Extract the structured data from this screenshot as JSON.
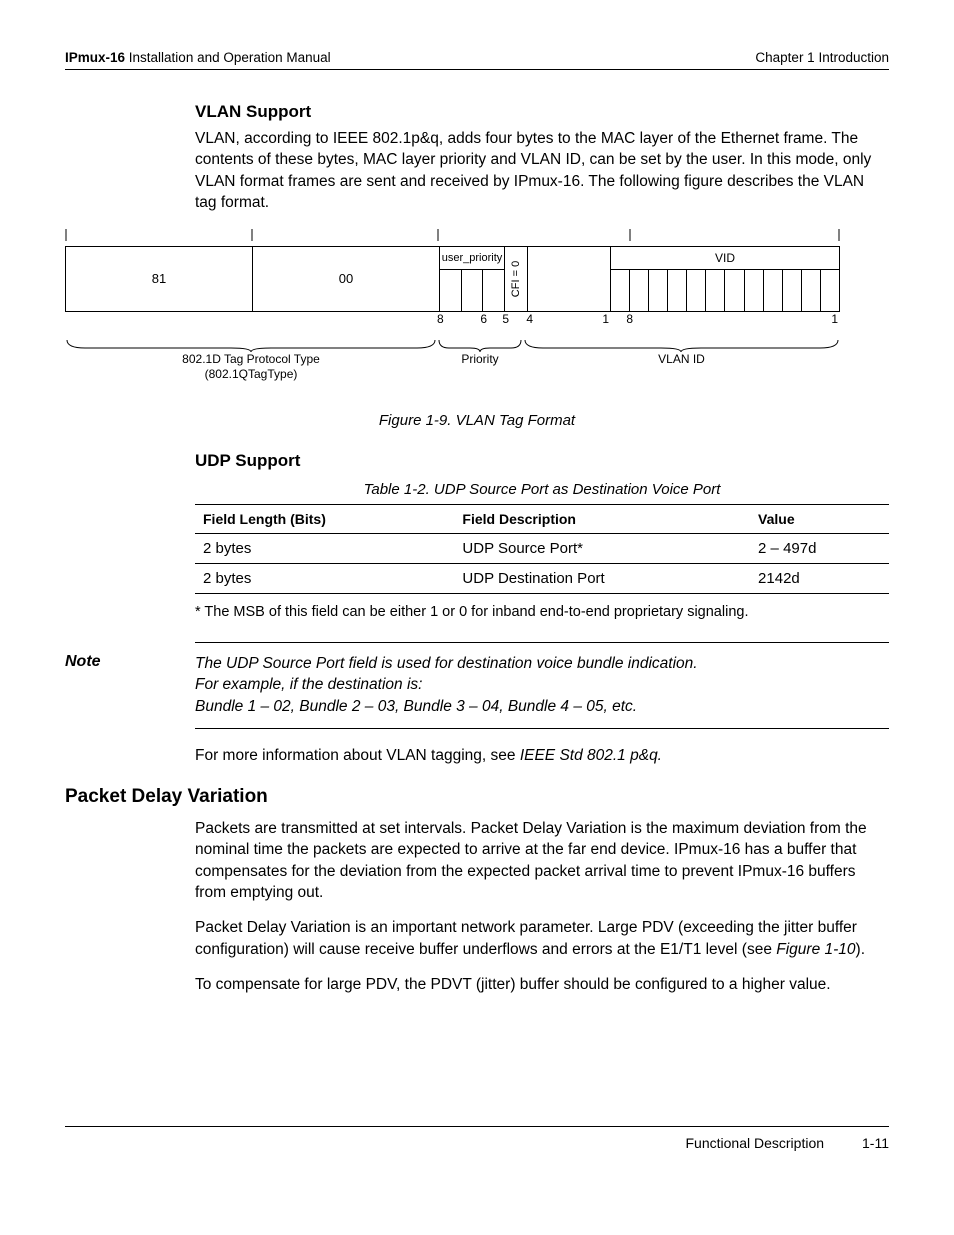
{
  "header": {
    "manual_bold": "IPmux-16",
    "manual_rest": " Installation and Operation Manual",
    "chapter": "Chapter 1  Introduction"
  },
  "vlan": {
    "heading": "VLAN Support",
    "para": "VLAN, according to IEEE 802.1p&q, adds four bytes to the MAC layer of the Ethernet frame. The contents of these bytes, MAC layer priority and VLAN ID, can be set by the user. In this mode, only VLAN format frames are sent and received by IPmux-16. The following figure describes the VLAN tag format.",
    "diagram": {
      "byte1": "81",
      "byte2": "00",
      "user_priority": "user_priority",
      "cfi": "CFI = 0",
      "vid": "VID",
      "ticks": {
        "a": "8",
        "b": "6",
        "c": "5",
        "d": "4",
        "e": "1",
        "f": "8",
        "g": "1"
      },
      "brace1_l1": "802.1D Tag Protocol Type",
      "brace1_l2": "(802.1QTagType)",
      "brace2": "Priority",
      "brace3": "VLAN ID"
    },
    "figcap": "Figure 1-9.  VLAN Tag Format"
  },
  "udp": {
    "heading": "UDP Support",
    "tabcap": "Table 1-2.  UDP Source Port as Destination Voice Port",
    "th1": "Field Length (Bits)",
    "th2": "Field Description",
    "th3": "Value",
    "rows": [
      {
        "c1": "2 bytes",
        "c2": "UDP Source Port*",
        "c3": "2 – 497d"
      },
      {
        "c1": "2 bytes",
        "c2": "UDP Destination Port",
        "c3": "2142d"
      }
    ],
    "footnote": "* The MSB of this field can be either 1 or 0 for inband end-to-end proprietary signaling."
  },
  "note": {
    "label": "Note",
    "l1": "The UDP Source Port field is used for destination voice bundle indication.",
    "l2": "For example, if the destination is:",
    "l3": "Bundle 1 – 02, Bundle 2 – 03, Bundle 3 – 04, Bundle 4 – 05, etc."
  },
  "moreinfo_pre": "For more information about VLAN tagging, see ",
  "moreinfo_it": "IEEE Std 802.1 p&q.",
  "pdv": {
    "heading": "Packet Delay Variation",
    "p1": "Packets are transmitted at set intervals. Packet Delay Variation is the maximum deviation from the nominal time the packets are expected to arrive at the far end device. IPmux-16 has a buffer that compensates for the deviation from the expected packet arrival time to prevent IPmux-16 buffers from emptying out.",
    "p2a": "Packet Delay Variation is an important network parameter. Large PDV (exceeding the jitter buffer configuration) will cause receive buffer underflows and errors at the E1/T1 level (see ",
    "p2it": "Figure 1-10",
    "p2b": ").",
    "p3": "To compensate for large PDV, the PDVT (jitter) buffer should be configured to a higher value."
  },
  "footer": {
    "section": "Functional Description",
    "page": "1-11"
  }
}
